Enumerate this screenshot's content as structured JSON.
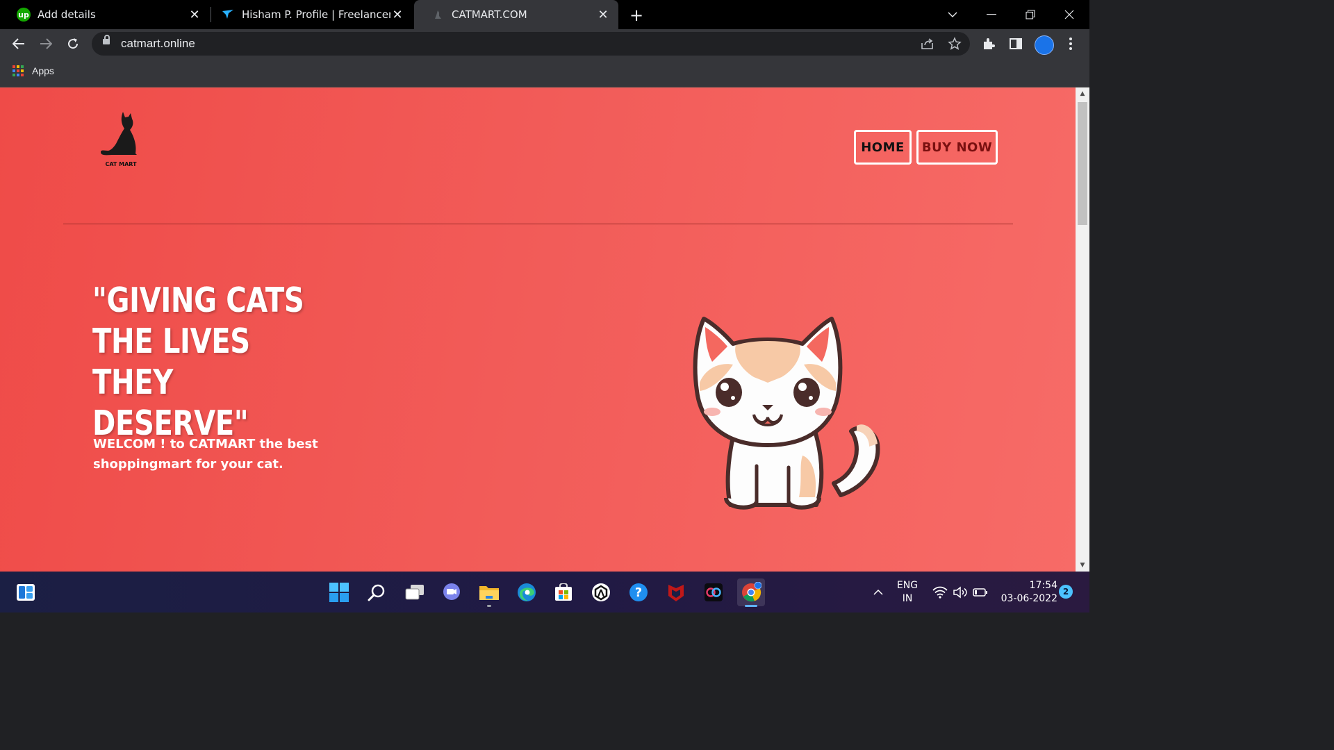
{
  "browser": {
    "tabs": [
      {
        "title": "Add details",
        "favicon": "upwork-icon",
        "favicon_text": "up"
      },
      {
        "title": "Hisham P. Profile | Freelancer",
        "favicon": "freelancer-icon"
      },
      {
        "title": "CATMART.COM",
        "favicon": "catmart-icon",
        "active": true
      }
    ],
    "url": "catmart.online",
    "bookmarks_apps_label": "Apps"
  },
  "site": {
    "logo_text": "CAT MART",
    "nav": {
      "home": "HOME",
      "buy_now": "BUY NOW"
    },
    "headline": "\"GIVING CATS THE LIVES THEY DESERVE\"",
    "welcome": "WELCOM ! to CATMART the best shoppingmart for your cat.",
    "colors": {
      "background": "#f25c59",
      "nav_border": "#ffffff",
      "headline": "#ffffff"
    }
  },
  "taskbar": {
    "language": "ENG",
    "region": "IN",
    "time": "17:54",
    "date": "03-06-2022",
    "notifications": "2"
  }
}
